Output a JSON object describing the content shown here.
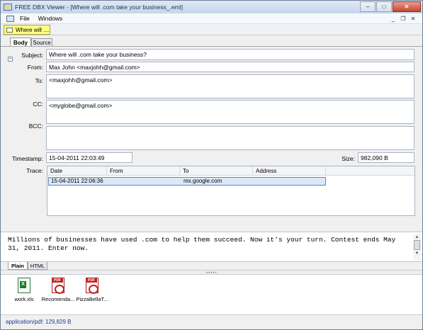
{
  "window": {
    "title": "FREE DBX Viewer - [Where will .com take your business_.eml]",
    "controls": {
      "minimize": "–",
      "maximize": "□",
      "close": "✕"
    }
  },
  "menubar": {
    "items": [
      "File",
      "Windows"
    ],
    "mdi_controls": {
      "minimize": "_",
      "restore": "❐",
      "close": "✕"
    }
  },
  "document_tab": {
    "label": "Where will ...."
  },
  "tabs": {
    "body": "Body",
    "source": "Source"
  },
  "headers": {
    "subject_label": "Subject:",
    "subject": "Where will .com take your business?",
    "from_label": "From:",
    "from": "Max John <maxjohh@gmail.com>",
    "to_label": "To:",
    "to": "<maxjohh@gmail.com>",
    "cc_label": "CC:",
    "cc": "<myglobe@gmail.com>",
    "bcc_label": "BCC:",
    "bcc": "",
    "timestamp_label": "Timestamp:",
    "timestamp": "15-04-2011 22:03:49",
    "size_label": "Size:",
    "size": "982,090 B",
    "trace_label": "Trace:"
  },
  "trace": {
    "columns": [
      "Date",
      "From",
      "To",
      "Address"
    ],
    "rows": [
      {
        "date": "15-04-2011 22:06:36",
        "from": "",
        "to": "mx.google.com",
        "address": ""
      }
    ]
  },
  "message": {
    "text": "Millions of businesses have used .com to help them succeed. Now it's your turn. Contest ends May 31, 2011. Enter now."
  },
  "view_tabs": {
    "plain": "Plain",
    "html": "HTML"
  },
  "attachments": [
    {
      "name": "work.xls",
      "icon": "excel-file-icon"
    },
    {
      "name": "Recomenda...",
      "icon": "pdf-file-icon"
    },
    {
      "name": "PizzaBellaT...",
      "icon": "pdf-file-icon"
    }
  ],
  "status": {
    "text": "application/pdf: 129,829 B"
  }
}
